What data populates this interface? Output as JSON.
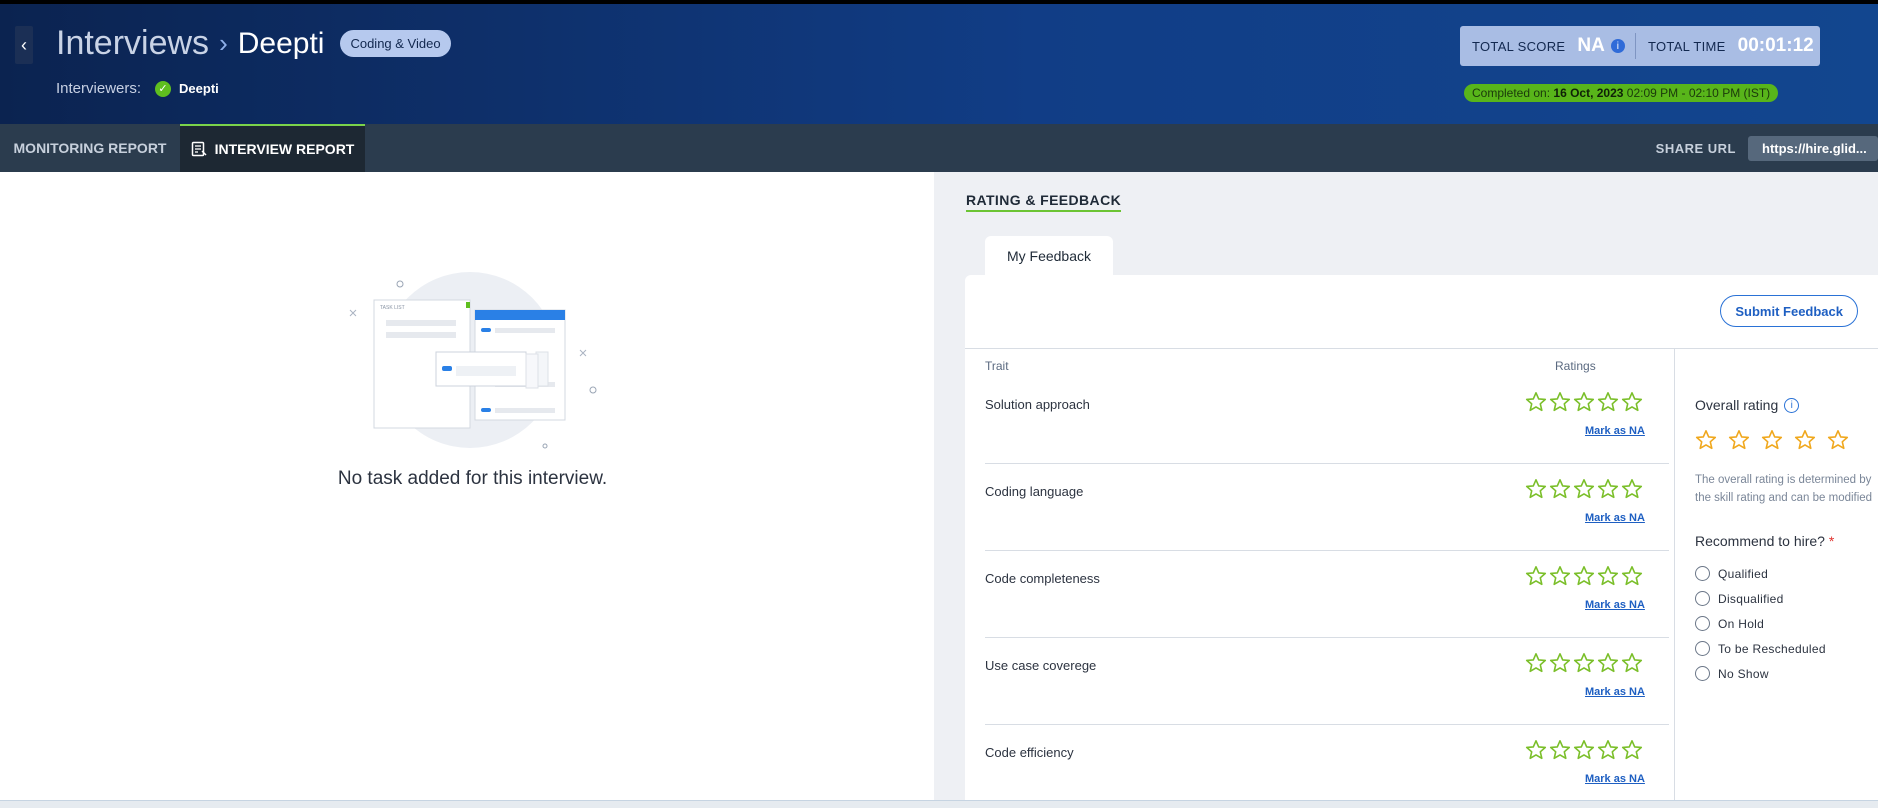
{
  "header": {
    "breadcrumb_root": "Interviews",
    "breadcrumb_sep": "›",
    "candidate": "Deepti",
    "badge": "Coding & Video",
    "interviewers_label": "Interviewers:",
    "interviewer": "Deepti",
    "total_score_label": "TOTAL SCORE",
    "total_score": "NA",
    "total_time_label": "TOTAL TIME",
    "total_time": "00:01:12",
    "completed_label": "Completed on:",
    "completed_date": "16 Oct, 2023",
    "completed_time": "02:09 PM - 02:10 PM (IST)"
  },
  "tabs": {
    "monitoring": "MONITORING REPORT",
    "interview": "INTERVIEW REPORT"
  },
  "share": {
    "label": "SHARE URL",
    "url": "https://hire.glid..."
  },
  "left": {
    "empty_message": "No task added for this interview.",
    "illustration_task_list": "TASK LIST"
  },
  "right": {
    "section_title": "RATING & FEEDBACK",
    "feedback_tab": "My Feedback",
    "submit_label": "Submit Feedback",
    "trait_header": "Trait",
    "ratings_header": "Ratings",
    "mark_na": "Mark as NA",
    "traits": [
      "Solution approach",
      "Coding language",
      "Code completeness",
      "Use case coverege",
      "Code efficiency"
    ],
    "overall_title": "Overall rating",
    "overall_note": "The overall rating is determined by the skill rating and can be modified",
    "recommend_label": "Recommend to hire?",
    "required_mark": "*",
    "options": [
      "Qualified",
      "Disqualified",
      "On Hold",
      "To be Rescheduled",
      "No Show"
    ]
  },
  "colors": {
    "header_bg": "#0b2350",
    "accent_green": "#6cc434",
    "star_green": "#7bbf2a",
    "star_orange": "#f0a81e",
    "link_blue": "#1e5fc2"
  },
  "icons": {
    "back": "chevron-left-icon",
    "separator": "chevron-right-icon",
    "verified": "check-circle-icon",
    "info": "info-icon",
    "report": "report-icon",
    "star": "star-outline-icon"
  }
}
